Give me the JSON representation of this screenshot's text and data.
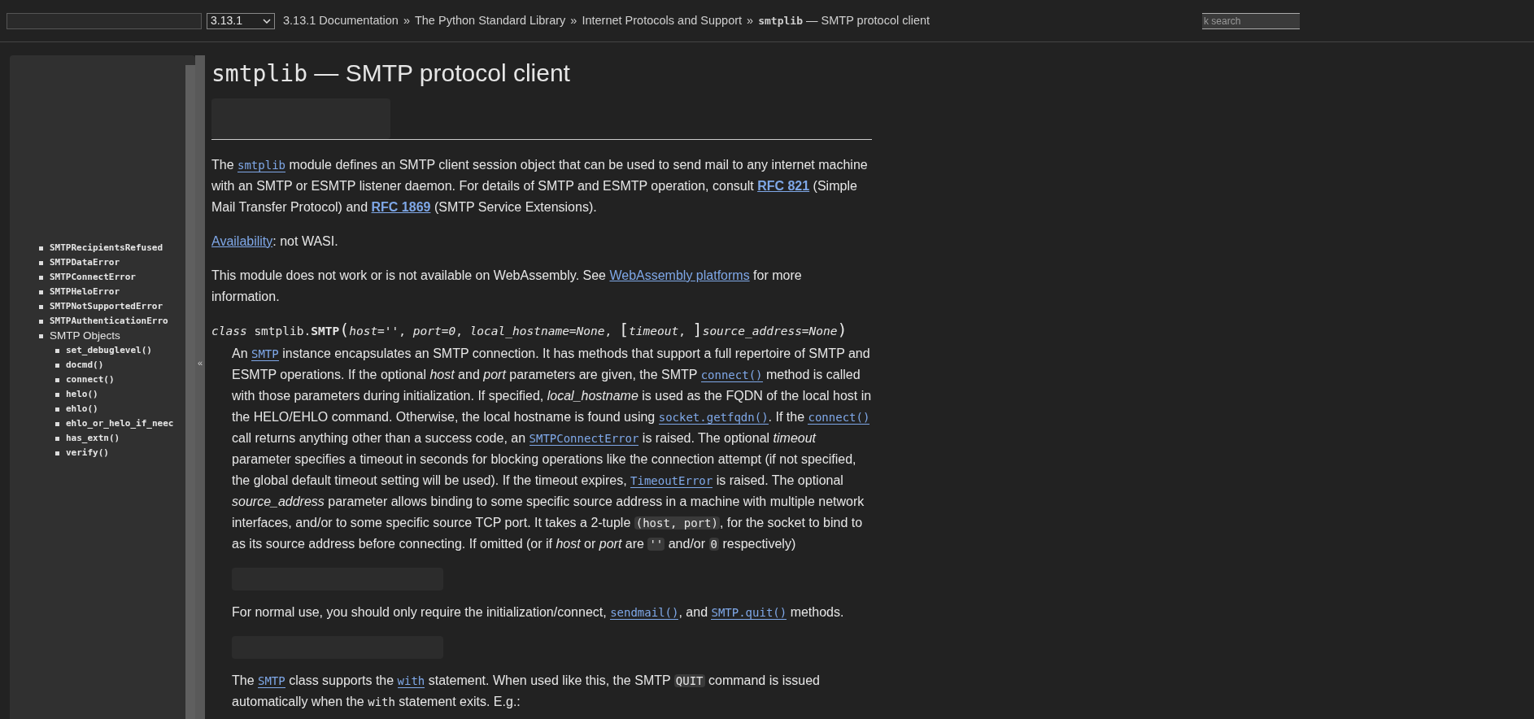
{
  "topbar": {
    "version_select": {
      "value": "3.13.1"
    },
    "breadcrumbs": [
      {
        "label": "3.13.1 Documentation",
        "separator": "»"
      },
      {
        "label": "The Python Standard Library",
        "separator": "»"
      },
      {
        "label": "Internet Protocols and Support",
        "separator": "»"
      }
    ],
    "current_page": {
      "module": "smtplib",
      "rest": "— SMTP protocol client"
    },
    "search": {
      "placeholder": "k search"
    }
  },
  "sidebar": {
    "items": [
      {
        "label": "SMTPRecipientsRefused",
        "kind": "code"
      },
      {
        "label": "SMTPDataError",
        "kind": "code"
      },
      {
        "label": "SMTPConnectError",
        "kind": "code"
      },
      {
        "label": "SMTPHeloError",
        "kind": "code"
      },
      {
        "label": "SMTPNotSupportedError",
        "kind": "code"
      },
      {
        "label": "SMTPAuthenticationErro",
        "kind": "code"
      },
      {
        "label": "SMTP Objects",
        "kind": "text",
        "children": [
          {
            "label": "set_debuglevel()",
            "kind": "code"
          },
          {
            "label": "docmd()",
            "kind": "code"
          },
          {
            "label": "connect()",
            "kind": "code"
          },
          {
            "label": "helo()",
            "kind": "code"
          },
          {
            "label": "ehlo()",
            "kind": "code"
          },
          {
            "label": "ehlo_or_helo_if_neec",
            "kind": "code"
          },
          {
            "label": "has_extn()",
            "kind": "code"
          },
          {
            "label": "verify()",
            "kind": "code"
          }
        ]
      }
    ],
    "collapse_button": "«"
  },
  "content": {
    "title": {
      "module": "smtplib",
      "rest": "— SMTP protocol client"
    },
    "paragraphs": [
      [
        {
          "kind": "text",
          "text": "The "
        },
        {
          "kind": "code_link",
          "text": "smtplib"
        },
        {
          "kind": "text",
          "text": " module defines an SMTP client session object that can be used to send mail to any internet machine with an SMTP or ESMTP listener daemon. For details of SMTP and ESMTP operation, consult "
        },
        {
          "kind": "bold_link",
          "text": "RFC 821"
        },
        {
          "kind": "text",
          "text": " (Simple Mail Transfer Protocol) and "
        },
        {
          "kind": "bold_link",
          "text": "RFC 1869"
        },
        {
          "kind": "text",
          "text": " (SMTP Service Extensions)."
        }
      ],
      [
        {
          "kind": "link",
          "text": "Availability"
        },
        {
          "kind": "text",
          "text": ": not WASI."
        }
      ],
      [
        {
          "kind": "text",
          "text": "This module does not work or is not available on WebAssembly. See "
        },
        {
          "kind": "link",
          "text": "WebAssembly platforms"
        },
        {
          "kind": "text",
          "text": " for more information."
        }
      ]
    ],
    "signature": [
      {
        "kind": "em",
        "text": "class"
      },
      {
        "kind": "plain",
        "text": " smtplib."
      },
      {
        "kind": "bold",
        "text": "SMTP"
      },
      {
        "kind": "big",
        "text": "("
      },
      {
        "kind": "em",
        "text": "host=''"
      },
      {
        "kind": "plain",
        "text": ", "
      },
      {
        "kind": "em",
        "text": "port=0"
      },
      {
        "kind": "plain",
        "text": ", "
      },
      {
        "kind": "em",
        "text": "local_hostname=None"
      },
      {
        "kind": "plain",
        "text": ", "
      },
      {
        "kind": "big",
        "text": "["
      },
      {
        "kind": "em",
        "text": "timeout"
      },
      {
        "kind": "plain",
        "text": ", "
      },
      {
        "kind": "big",
        "text": "]"
      },
      {
        "kind": "em",
        "text": "source_address=None"
      },
      {
        "kind": "big",
        "text": ")"
      }
    ],
    "description": [
      [
        {
          "kind": "text",
          "text": "An "
        },
        {
          "kind": "code_link",
          "text": "SMTP"
        },
        {
          "kind": "text",
          "text": " instance encapsulates an SMTP connection. It has methods that support a full repertoire of SMTP and ESMTP operations. If the optional "
        },
        {
          "kind": "em",
          "text": "host"
        },
        {
          "kind": "text",
          "text": " and "
        },
        {
          "kind": "em",
          "text": "port"
        },
        {
          "kind": "text",
          "text": " parameters are given, the SMTP "
        },
        {
          "kind": "code_link",
          "text": "connect()"
        },
        {
          "kind": "text",
          "text": " method is called with those parameters during initialization. If specified, "
        },
        {
          "kind": "em",
          "text": "local_hostname"
        },
        {
          "kind": "text",
          "text": " is used as the FQDN of the local host in the HELO/EHLO command. Otherwise, the local hostname is found using "
        },
        {
          "kind": "code_link",
          "text": "socket.getfqdn()"
        },
        {
          "kind": "text",
          "text": ". If the "
        },
        {
          "kind": "code_link",
          "text": "connect()"
        },
        {
          "kind": "text",
          "text": " call returns anything other than a success code, an "
        },
        {
          "kind": "code_link",
          "text": "SMTPConnectError"
        },
        {
          "kind": "text",
          "text": " is raised. The optional "
        },
        {
          "kind": "em",
          "text": "timeout"
        },
        {
          "kind": "text",
          "text": " parameter specifies a timeout in seconds for blocking operations like the connection attempt (if not specified, the global default timeout setting will be used). If the timeout expires, "
        },
        {
          "kind": "code_link",
          "text": "TimeoutError"
        },
        {
          "kind": "text",
          "text": " is raised. The optional "
        },
        {
          "kind": "em",
          "text": "source_address"
        },
        {
          "kind": "text",
          "text": " parameter allows binding to some specific source address in a machine with multiple network interfaces, and/or to some specific source TCP port. It takes a 2-tuple "
        },
        {
          "kind": "code",
          "text": "(host, port)"
        },
        {
          "kind": "text",
          "text": ", for the socket to bind to as its source address before connecting. If omitted (or if "
        },
        {
          "kind": "em",
          "text": "host"
        },
        {
          "kind": "text",
          "text": " or "
        },
        {
          "kind": "em",
          "text": "port"
        },
        {
          "kind": "text",
          "text": " are "
        },
        {
          "kind": "code",
          "text": "''"
        },
        {
          "kind": "text",
          "text": " and/or "
        },
        {
          "kind": "code",
          "text": "0"
        },
        {
          "kind": "text",
          "text": " respectively)"
        }
      ],
      [
        {
          "kind": "text",
          "text": "For normal use, you should only require the initialization/connect, "
        },
        {
          "kind": "code_link",
          "text": "sendmail()"
        },
        {
          "kind": "text",
          "text": ", and "
        },
        {
          "kind": "code_link",
          "text": "SMTP.quit()"
        },
        {
          "kind": "text",
          "text": " methods."
        }
      ],
      [
        {
          "kind": "text",
          "text": "The "
        },
        {
          "kind": "code_link",
          "text": "SMTP"
        },
        {
          "kind": "text",
          "text": " class supports the "
        },
        {
          "kind": "code_link",
          "text": "with"
        },
        {
          "kind": "text",
          "text": " statement. When used like this, the SMTP "
        },
        {
          "kind": "code",
          "text": "QUIT"
        },
        {
          "kind": "text",
          "text": " command is issued automatically when the "
        },
        {
          "kind": "mono",
          "text": "with"
        },
        {
          "kind": "text",
          "text": " statement exits. E.g.:"
        }
      ]
    ]
  }
}
